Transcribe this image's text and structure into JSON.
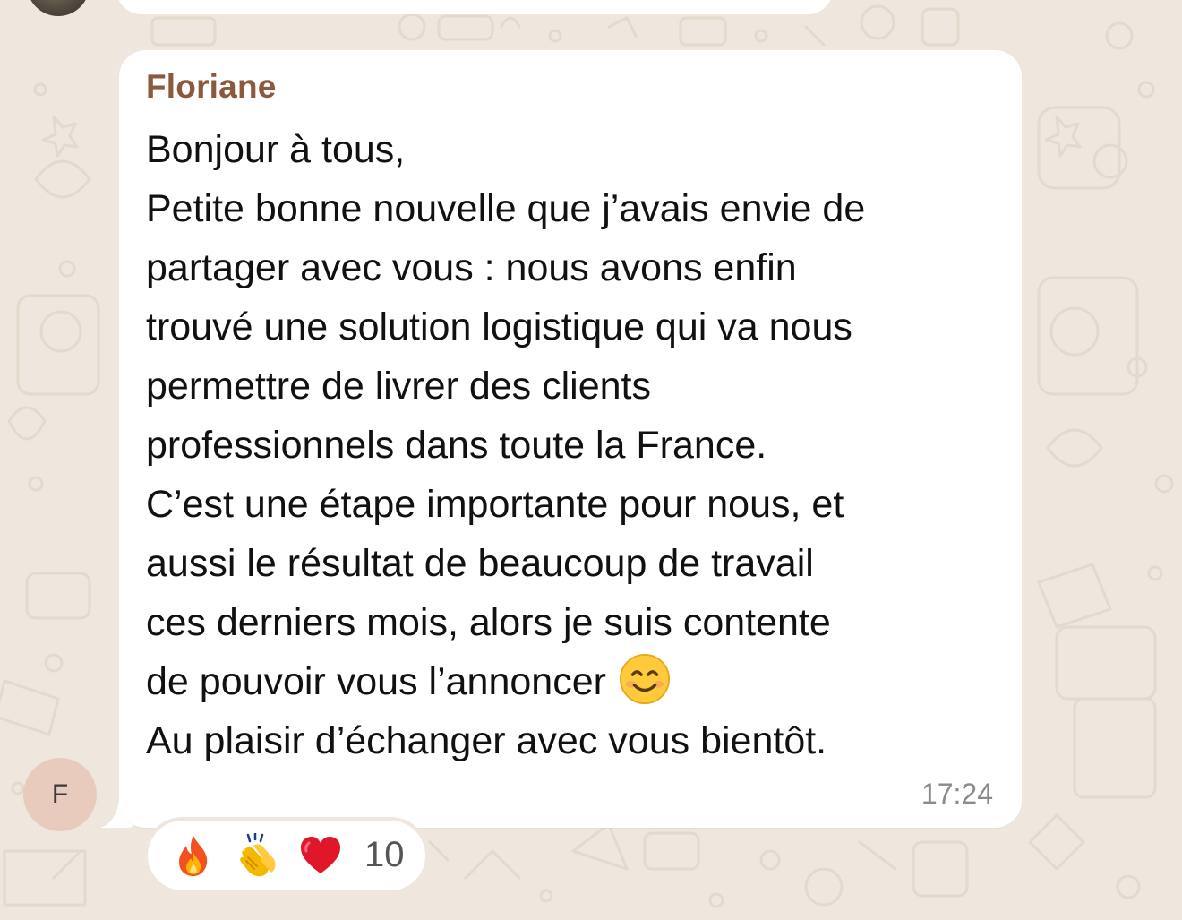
{
  "message": {
    "sender": "Floriane",
    "lines": [
      "Bonjour à tous,",
      "Petite bonne nouvelle que j’avais envie de",
      "partager avec vous : nous avons enfin",
      "trouvé une solution logistique qui va nous",
      "permettre de livrer des clients",
      "professionnels dans toute la France.",
      "C’est une étape importante pour nous, et",
      "aussi le résultat de beaucoup de travail",
      "ces derniers mois, alors je suis contente",
      "de pouvoir vous l’annoncer",
      "Au plaisir d’échanger avec vous bientôt."
    ],
    "inline_emoji": "smiling-face-icon",
    "time": "17:24"
  },
  "avatar": {
    "initial": "F",
    "color": "#E9CBBE"
  },
  "reactions": {
    "icons": [
      "fire-icon",
      "clapping-hands-icon",
      "red-heart-icon"
    ],
    "count": "10"
  },
  "colors": {
    "background": "#EFE7DD",
    "bubble": "#FFFFFF",
    "sender": "#8B5A3C",
    "time": "#8A8A8A"
  }
}
